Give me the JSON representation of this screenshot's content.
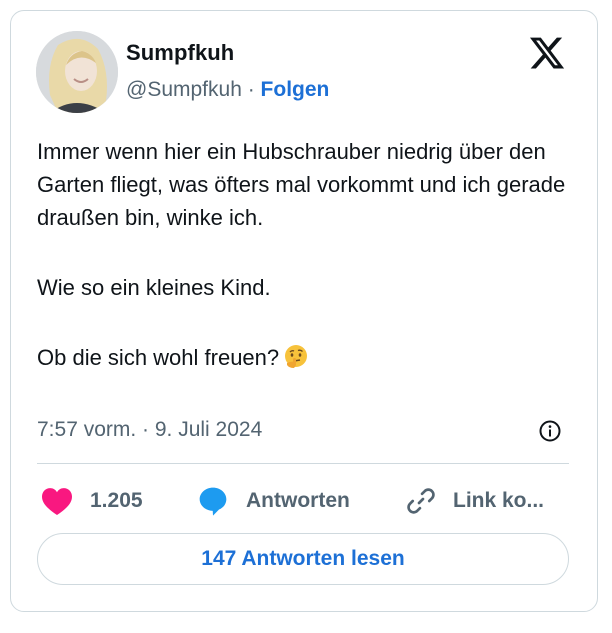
{
  "user": {
    "display_name": "Sumpfkuh",
    "handle": "@Sumpfkuh",
    "separator": " · ",
    "follow_label": "Folgen"
  },
  "tweet": {
    "paragraph_1": "Immer wenn hier ein Hubschrauber niedrig über den Garten fliegt, was öfters mal vorkommt und ich gerade draußen bin, winke ich.",
    "paragraph_2": "Wie so ein kleines Kind.",
    "paragraph_3": "Ob die sich wohl freuen?",
    "emoji": "thinking-face-icon",
    "timestamp": "7:57 vorm. · 9. Juli 2024"
  },
  "actions": {
    "likes_count": "1.205",
    "reply_label": "Antworten",
    "link_label": "Link ko..."
  },
  "read_replies_label": "147 Antworten lesen",
  "colors": {
    "accent": "#1d70d6",
    "like": "#f91880",
    "reply_icon": "#1d9bf0",
    "muted": "#536471",
    "border": "#cfd9de"
  }
}
